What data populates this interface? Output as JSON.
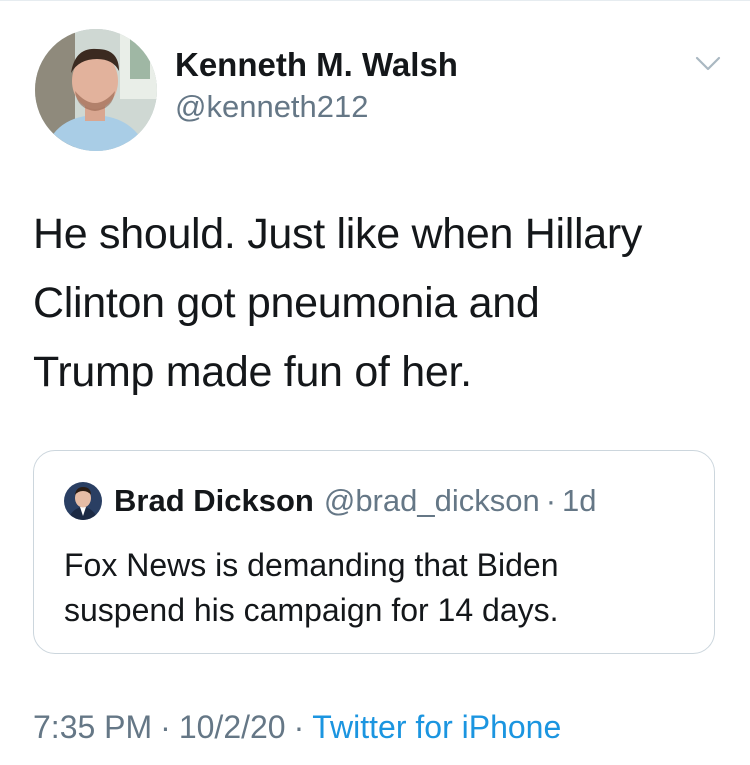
{
  "tweet": {
    "author": {
      "name": "Kenneth M. Walsh",
      "handle": "@kenneth212"
    },
    "text_lines": [
      "He should. Just like when Hillary",
      "Clinton got pneumonia and",
      "Trump made fun of her."
    ],
    "quoted": {
      "name": "Brad Dickson",
      "handle": "@brad_dickson",
      "separator": "·",
      "time": "1d",
      "text_lines": [
        "Fox News is demanding that Biden",
        "suspend his campaign for 14 days."
      ]
    },
    "meta": {
      "time": "7:35 PM",
      "dot1": "·",
      "date": "10/2/20",
      "dot2": "·",
      "source": "Twitter for iPhone"
    }
  },
  "icons": {
    "more": "chevron-down-icon"
  },
  "colors": {
    "text": "#14171a",
    "secondary": "#657786",
    "link": "#1b95e0",
    "border": "#ccd6dd"
  }
}
